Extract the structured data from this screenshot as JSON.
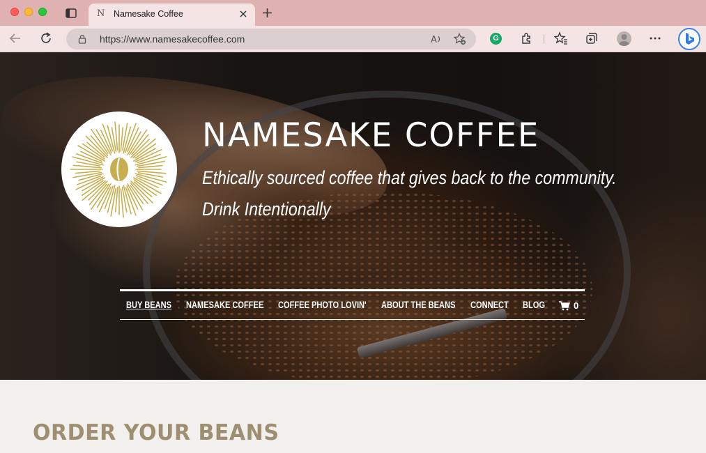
{
  "browser": {
    "tab": {
      "favicon": "N",
      "title": "Namesake Coffee"
    },
    "address_url": "https://www.namesakecoffee.com",
    "extension_label": "G",
    "icons": [
      "back-icon",
      "reload-icon",
      "lock-icon",
      "read-aloud-icon",
      "add-favorite-icon",
      "grammarly-icon",
      "extensions-icon",
      "favorites-icon",
      "collections-icon",
      "profile-icon",
      "more-icon",
      "bing-icon"
    ]
  },
  "hero": {
    "title": "NAMESAKE COFFEE",
    "tagline": "Ethically sourced coffee that gives back to the community.",
    "tagline2": "Drink Intentionally"
  },
  "nav": {
    "items": [
      {
        "label": "BUY BEANS",
        "active": true
      },
      {
        "label": "NAMESAKE COFFEE"
      },
      {
        "label": "COFFEE PHOTO LOVIN'"
      },
      {
        "label": "ABOUT THE BEANS"
      },
      {
        "label": "CONNECT"
      },
      {
        "label": "BLOG"
      }
    ],
    "cart_count": "0"
  },
  "content": {
    "section_title": "ORDER YOUR BEANS"
  },
  "colors": {
    "tabbar": "#dfb1b1",
    "logo_gold": "#c9ae4f",
    "section_title": "#9e8f72",
    "page_bg": "#f1f0ec"
  }
}
